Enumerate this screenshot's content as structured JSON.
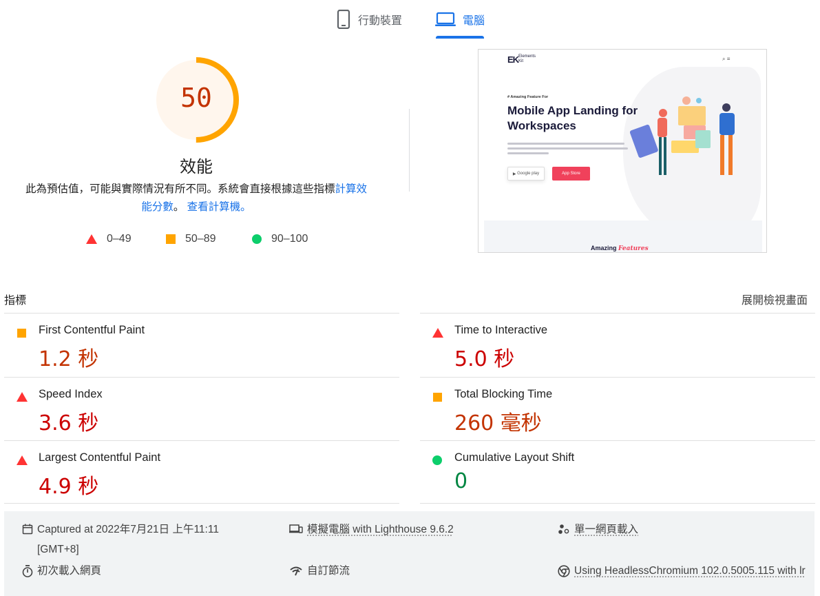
{
  "tabs": {
    "mobile_label": "行動裝置",
    "desktop_label": "電腦",
    "active": "desktop"
  },
  "score": {
    "value": "50",
    "fraction": 0.5,
    "title": "效能",
    "description_prefix": "此為預估值，可能與實際情況有所不同。系統會直接根據這些指標",
    "description_link": "計算效能分數",
    "description_sep": "。",
    "calculator_link": "查看計算機。",
    "color": "#ffa400",
    "bg_color": "#fff6ed",
    "text_color": "#c33300"
  },
  "legend": {
    "fail": "0–49",
    "average": "50–89",
    "pass": "90–100"
  },
  "screenshot": {
    "logo": "Elements Kit",
    "eyebrow": "# Amazing Feature For",
    "headline": "Mobile App Landing for Workspaces",
    "google_play": "Google play",
    "app_store": "App Store",
    "bottom_text": "Amazing",
    "bottom_text_accent": "Features"
  },
  "metrics": {
    "header": "指標",
    "expand_label": "展開檢視畫面",
    "fcp": {
      "title": "First Contentful Paint",
      "value": "1.2 秒",
      "rating": "average"
    },
    "si": {
      "title": "Speed Index",
      "value": "3.6 秒",
      "rating": "fail"
    },
    "lcp": {
      "title": "Largest Contentful Paint",
      "value": "4.9 秒",
      "rating": "fail"
    },
    "tti": {
      "title": "Time to Interactive",
      "value": "5.0 秒",
      "rating": "fail"
    },
    "tbt": {
      "title": "Total Blocking Time",
      "value": "260 毫秒",
      "rating": "average"
    },
    "cls": {
      "title": "Cumulative Layout Shift",
      "value": "0",
      "rating": "pass"
    }
  },
  "runtime": {
    "captured": "Captured at 2022年7月21日 上午11:11 [GMT+8]",
    "emulation": "模擬電腦 with Lighthouse 9.6.2",
    "single_page": "單一網頁載入",
    "initial_load": "初次載入網頁",
    "throttling": "自訂節流",
    "browser": "Using HeadlessChromium 102.0.5005.115 with lr"
  }
}
